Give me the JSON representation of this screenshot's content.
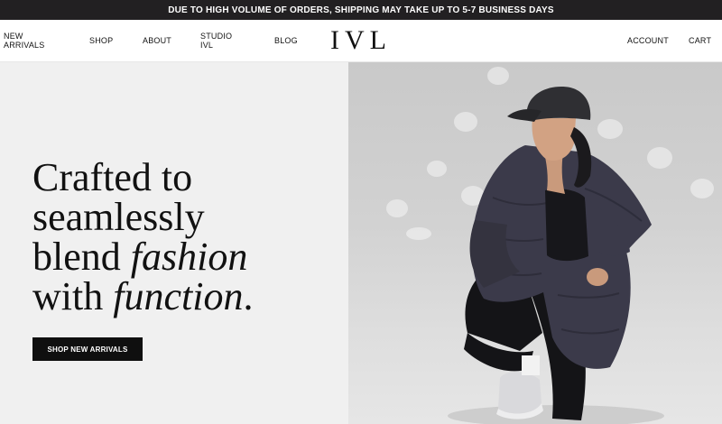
{
  "announcement": {
    "text": "DUE TO HIGH VOLUME OF ORDERS, SHIPPING MAY TAKE UP TO 5-7 BUSINESS DAYS"
  },
  "header": {
    "nav_left": [
      {
        "label": "NEW ARRIVALS"
      },
      {
        "label": "SHOP"
      },
      {
        "label": "ABOUT"
      },
      {
        "label": "STUDIO IVL"
      },
      {
        "label": "BLOG"
      }
    ],
    "logo": "IVL",
    "nav_right": [
      {
        "label": "ACCOUNT"
      },
      {
        "label": "CART"
      }
    ]
  },
  "hero": {
    "headline": {
      "line1": "Crafted to",
      "line2": "seamlessly",
      "line3_prefix": "blend ",
      "line3_italic": "fashion",
      "line4_prefix": "with ",
      "line4_italic": "function",
      "line4_suffix": "."
    },
    "cta_label": "SHOP NEW ARRIVALS"
  },
  "colors": {
    "announcement_bg": "#222022",
    "hero_left_bg": "#f0f0f0",
    "cta_bg": "#0f0f0f",
    "jacket": "#3b3a4a"
  }
}
